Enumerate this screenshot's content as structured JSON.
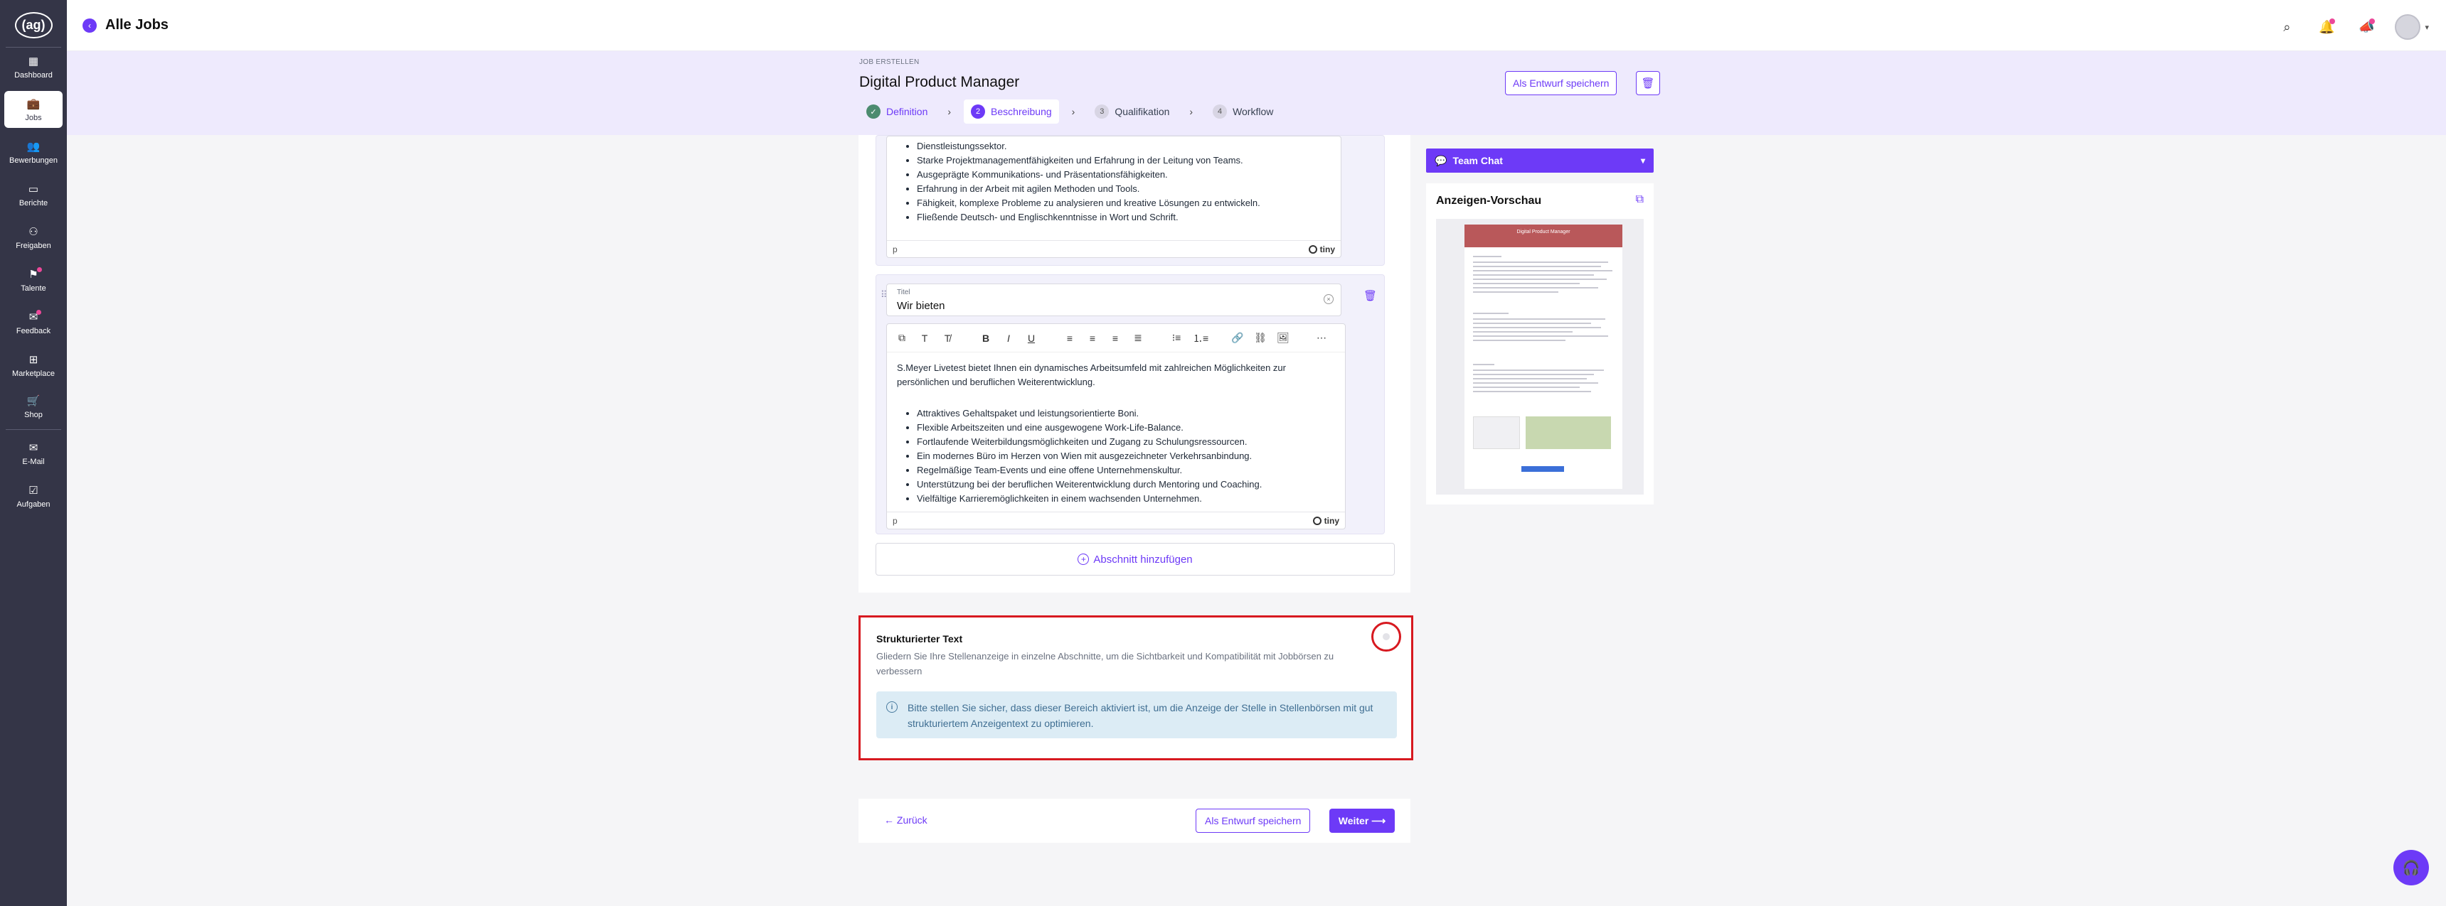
{
  "sidebar": {
    "logo": "(ag)",
    "items": [
      {
        "label": "Dashboard",
        "icon": "dashboard-icon"
      },
      {
        "label": "Jobs",
        "icon": "briefcase-icon"
      },
      {
        "label": "Bewerbungen",
        "icon": "users-icon"
      },
      {
        "label": "Berichte",
        "icon": "chart-icon"
      },
      {
        "label": "Freigaben",
        "icon": "share-icon"
      },
      {
        "label": "Talente",
        "icon": "talent-icon"
      },
      {
        "label": "Feedback",
        "icon": "feedback-icon"
      },
      {
        "label": "Marketplace",
        "icon": "marketplace-icon"
      },
      {
        "label": "Shop",
        "icon": "shop-icon"
      },
      {
        "label": "E-Mail",
        "icon": "mail-icon"
      },
      {
        "label": "Aufgaben",
        "icon": "tasks-icon"
      }
    ]
  },
  "topbar": {
    "title": "Alle Jobs"
  },
  "header": {
    "breadcrumb": "JOB ERSTELLEN",
    "job_title": "Digital Product Manager",
    "draft_label": "Als Entwurf speichern",
    "steps": [
      {
        "num": "✓",
        "label": "Definition",
        "state": "done"
      },
      {
        "num": "2",
        "label": "Beschreibung",
        "state": "active"
      },
      {
        "num": "3",
        "label": "Qualifikation",
        "state": "todo"
      },
      {
        "num": "4",
        "label": "Workflow",
        "state": "todo"
      }
    ]
  },
  "editor1": {
    "bullets": [
      "Dienstleistungssektor.",
      "Starke Projektmanagementfähigkeiten und Erfahrung in der Leitung von Teams.",
      "Ausgeprägte Kommunikations- und Präsentationsfähigkeiten.",
      "Erfahrung in der Arbeit mit agilen Methoden und Tools.",
      "Fähigkeit, komplexe Probleme zu analysieren und kreative Lösungen zu entwickeln.",
      "Fließende Deutsch- und Englischkenntnisse in Wort und Schrift."
    ],
    "status": "p",
    "brand": "tiny"
  },
  "section2": {
    "title_label": "Titel",
    "title_value": "Wir bieten",
    "intro": "S.Meyer Livetest bietet Ihnen ein dynamisches Arbeitsumfeld mit zahlreichen Möglichkeiten zur persönlichen und beruflichen Weiterentwicklung.",
    "bullets": [
      "Attraktives Gehaltspaket und leistungsorientierte Boni.",
      "Flexible Arbeitszeiten und eine ausgewogene Work-Life-Balance.",
      "Fortlaufende Weiterbildungsmöglichkeiten und Zugang zu Schulungsressourcen.",
      "Ein modernes Büro im Herzen von Wien mit ausgezeichneter Verkehrsanbindung.",
      "Regelmäßige Team-Events und eine offene Unternehmenskultur.",
      "Unterstützung bei der beruflichen Weiterentwicklung durch Mentoring und Coaching.",
      "Vielfältige Karrieremöglichkeiten in einem wachsenden Unternehmen."
    ],
    "status": "p",
    "brand": "tiny"
  },
  "add_section_label": "Abschnitt hinzufügen",
  "structured": {
    "title": "Strukturierter Text",
    "description": "Gliedern Sie Ihre Stellenanzeige in einzelne Abschnitte, um die Sichtbarkeit und Kompatibilität mit Jobbörsen zu verbessern",
    "info": "Bitte stellen Sie sicher, dass dieser Bereich aktiviert ist, um die Anzeige der Stelle in Stellenbörsen mit gut strukturiertem Anzeigentext zu optimieren."
  },
  "footer": {
    "back": "← Zurück",
    "draft": "Als Entwurf speichern",
    "next": "Weiter ⟶"
  },
  "right": {
    "team_chat": "Team Chat",
    "preview_title": "Anzeigen-Vorschau",
    "mini_header": "Digital Product Manager"
  },
  "colors": {
    "accent": "#6d3af7",
    "sidebar": "#343547",
    "highlight": "#d71920",
    "info_bg": "#dcecf5"
  }
}
